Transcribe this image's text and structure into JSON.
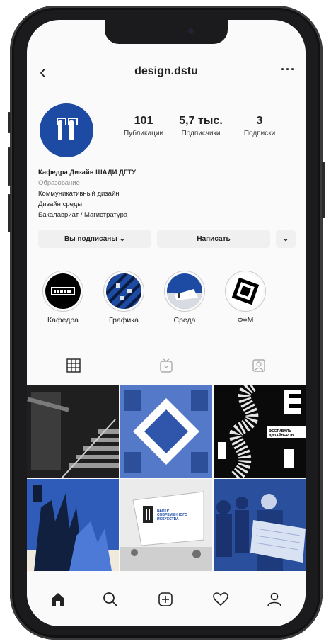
{
  "profile": {
    "username": "design.dstu",
    "back_icon": "chevron-left-icon",
    "more_icon": "more-dots-icon",
    "avatar_color": "#1d4aa3"
  },
  "stats": [
    {
      "value": "101",
      "label": "Публикации"
    },
    {
      "value": "5,7 тыс.",
      "label": "Подписчики"
    },
    {
      "value": "3",
      "label": "Подписки"
    }
  ],
  "bio": {
    "name": "Кафедра Дизайн ШАДИ ДГТУ",
    "category": "Образование",
    "lines": [
      "Коммуникативный дизайн",
      "Дизайн среды",
      "Бакалавриат / Магистратура"
    ]
  },
  "actions": {
    "following_label": "Вы подписаны ⌄",
    "message_label": "Написать",
    "suggest_icon": "chevron-down-icon"
  },
  "highlights": [
    {
      "label": "Кафедра"
    },
    {
      "label": "Графика"
    },
    {
      "label": "Среда"
    },
    {
      "label": "Ф=М"
    }
  ],
  "tabs": [
    "grid-icon",
    "igtv-icon",
    "tagged-icon"
  ],
  "grid_posts": [
    {
      "caption": ""
    },
    {
      "caption": ""
    },
    {
      "caption": "ФЕСТИВАЛЬ ДИЗАЙНЕРОВ"
    },
    {
      "caption": ""
    },
    {
      "caption": "ЦЕНТР СОВРЕМЕННОГО ИСКУССТВА"
    },
    {
      "caption": ""
    }
  ],
  "bottom_nav": [
    "home-icon",
    "search-icon",
    "add-post-icon",
    "heart-icon",
    "profile-icon"
  ],
  "colors": {
    "accent": "#1d4aa3",
    "background": "#fafafa",
    "text": "#222222"
  }
}
